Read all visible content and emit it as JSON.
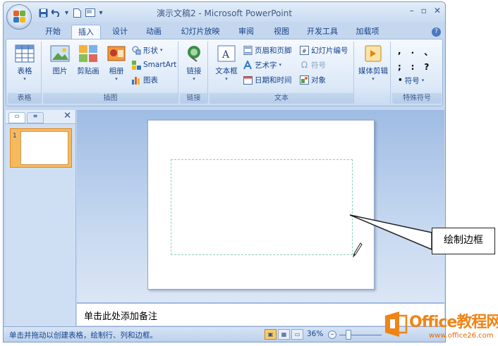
{
  "window": {
    "title": "演示文稿2 - Microsoft PowerPoint",
    "controls": [
      "–",
      "▫",
      "✕"
    ]
  },
  "tabs": [
    {
      "label": "开始"
    },
    {
      "label": "插入",
      "active": true
    },
    {
      "label": "设计"
    },
    {
      "label": "动画"
    },
    {
      "label": "幻灯片放映"
    },
    {
      "label": "审阅"
    },
    {
      "label": "视图"
    },
    {
      "label": "开发工具"
    },
    {
      "label": "加载项"
    }
  ],
  "ribbon": {
    "tables": {
      "button": "表格",
      "group": "表格"
    },
    "illustrations": {
      "picture": "图片",
      "clipart": "剪贴画",
      "album": "相册",
      "shapes": "形状",
      "smartart": "SmartArt",
      "chart": "图表",
      "group": "插图"
    },
    "links": {
      "button": "链接",
      "group": "链接"
    },
    "text": {
      "textbox": "文本框",
      "header_footer": "页眉和页脚",
      "wordart": "艺术字",
      "datetime": "日期和时间",
      "slide_number": "幻灯片编号",
      "symbol": "符号",
      "object": "对象",
      "group": "文本"
    },
    "media": {
      "button": "媒体剪辑"
    },
    "special": {
      "symbol": "符号",
      "group": "特殊符号",
      "chars": [
        ",",
        ".",
        "、",
        ";",
        ":",
        "?"
      ]
    }
  },
  "slides_pane": {
    "slide_number": "1"
  },
  "notes": {
    "placeholder": "单击此处添加备注"
  },
  "status": {
    "hint": "单击并拖动以创建表格，绘制行、列和边框。",
    "zoom": "36%"
  },
  "callout": {
    "text": "绘制边框"
  },
  "watermark": {
    "title": "Office教程网",
    "url": "www.office26.com"
  }
}
